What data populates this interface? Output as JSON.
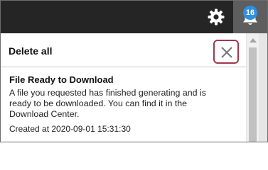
{
  "topbar": {
    "settings_icon": "gear-icon",
    "notifications_icon": "bell-icon",
    "notification_count": "16"
  },
  "panel": {
    "delete_all_label": "Delete all",
    "sort_icon": "sort-lines-icon",
    "notifications": [
      {
        "title": "File Ready to Download",
        "body": "A file you requested has finished generating and is ready to be downloaded. You can find it in the Download Center.",
        "created_at": "Created at 2020-09-01 15:31:30",
        "close_icon": "close-icon"
      }
    ]
  },
  "colors": {
    "topbar_bg": "#252525",
    "bell_bg": "#5e5e5e",
    "badge_bg": "#2f8fe0",
    "close_highlight": "#a1374b"
  }
}
